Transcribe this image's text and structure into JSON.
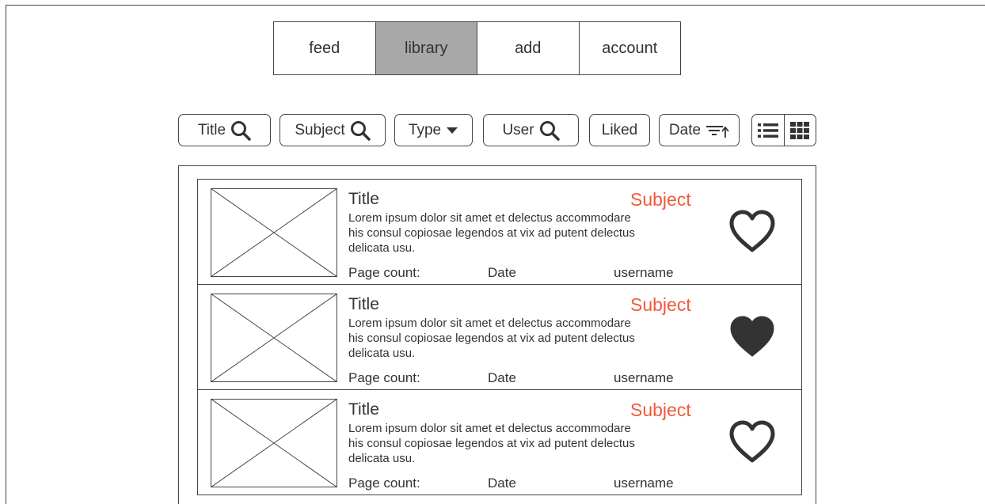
{
  "nav": {
    "tabs": [
      {
        "label": "feed",
        "active": false
      },
      {
        "label": "library",
        "active": true
      },
      {
        "label": "add",
        "active": false
      },
      {
        "label": "account",
        "active": false
      }
    ],
    "active_color": "#a8a8a8"
  },
  "filters": {
    "title_label": "Title",
    "subject_label": "Subject",
    "type_label": "Type",
    "user_label": "User",
    "liked_label": "Liked",
    "date_label": "Date"
  },
  "icons": {
    "search": "search-icon",
    "dropdown": "caret-down-icon",
    "sort": "sort-ascending-icon",
    "list_view": "list-view-icon",
    "grid_view": "grid-view-icon",
    "heart": "heart-icon"
  },
  "accent_color": "#f05a3c",
  "items": [
    {
      "title": "Title",
      "description": "Lorem ipsum dolor sit amet et delectus accommodare his consul copiosae legendos at vix ad putent delectus delicata usu.",
      "subject": "Subject",
      "page_count_label": "Page count:",
      "date": "Date",
      "username": "username",
      "liked": false
    },
    {
      "title": "Title",
      "description": "Lorem ipsum dolor sit amet et delectus accommodare his consul copiosae legendos at vix ad putent delectus delicata usu.",
      "subject": "Subject",
      "page_count_label": "Page count:",
      "date": "Date",
      "username": "username",
      "liked": true
    },
    {
      "title": "Title",
      "description": "Lorem ipsum dolor sit amet et delectus accommodare his consul copiosae legendos at vix ad putent delectus delicata usu.",
      "subject": "Subject",
      "page_count_label": "Page count:",
      "date": "Date",
      "username": "username",
      "liked": false
    }
  ]
}
